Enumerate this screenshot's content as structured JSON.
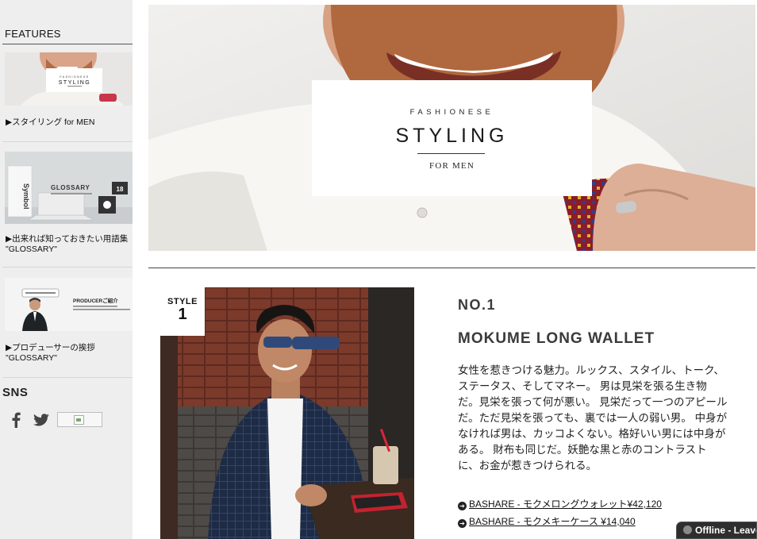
{
  "sidebar": {
    "features_title": "FEATURES",
    "items": [
      {
        "label": "▶スタイリング for MEN",
        "thumb_caption": "STYLING"
      },
      {
        "label": "▶出来れば知っておきたい用語集 \"GLOSSARY\"",
        "thumb_caption": "GLOSSARY"
      },
      {
        "label": "▶プロデューサーの挨拶 \"GLOSSARY\"",
        "thumb_caption": "PRODUCERご紹介"
      }
    ],
    "sns_title": "SNS"
  },
  "hero": {
    "subtitle": "FASHIONESE",
    "title": "STYLING",
    "for_text": "FOR MEN"
  },
  "product": {
    "badge_label": "STYLE",
    "badge_number": "1",
    "number": "NO.1",
    "name": "MOKUME LONG WALLET",
    "description": "女性を惹きつける魅力。ルックス、スタイル、トーク、ステータス、そしてマネー。 男は見栄を張る生き物だ。見栄を張って何が悪い。 見栄だって一つのアピールだ。ただ見栄を張っても、裏では一人の弱い男。 中身がなければ男は、カッコよくない。格好いい男には中身がある。 財布も同じだ。妖艶な黒と赤のコントラストに、お金が惹きつけられる。",
    "links": [
      {
        "text": "BASHARE - モクメロングウォレット¥42,120"
      },
      {
        "text": "BASHARE - モクメキーケース ¥14,040"
      }
    ]
  },
  "status": {
    "offline_text": "Offline - Leave"
  },
  "icons": {
    "facebook": "facebook-icon",
    "twitter": "twitter-icon",
    "link_bullet": "arrow-circle-icon"
  }
}
